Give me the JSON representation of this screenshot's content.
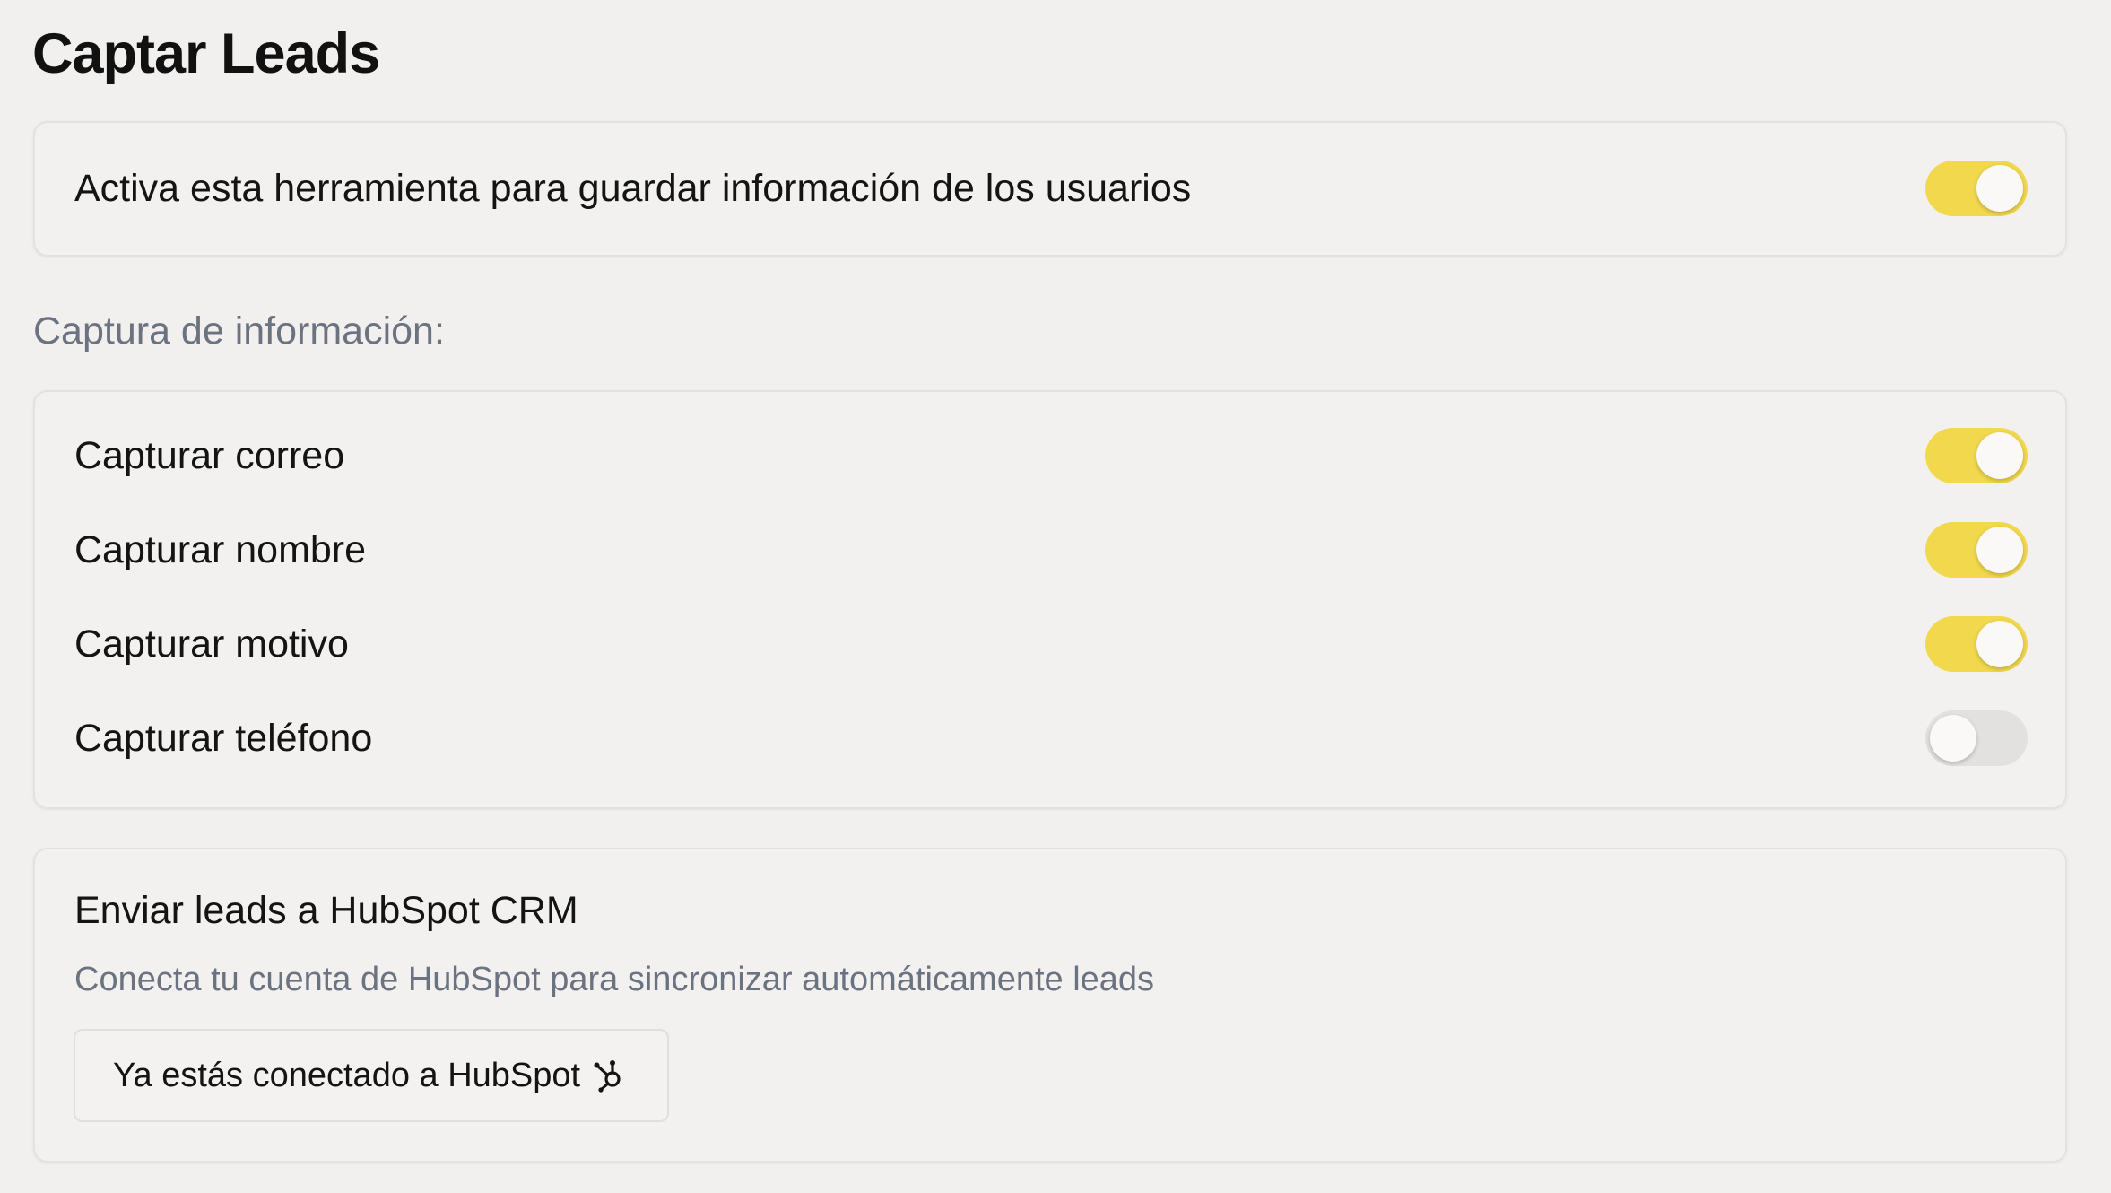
{
  "page": {
    "title": "Captar Leads"
  },
  "main_toggle": {
    "label": "Activa esta herramienta para guardar información de los usuarios",
    "enabled": true
  },
  "capture": {
    "section_label": "Captura de información:",
    "items": [
      {
        "label": "Capturar correo",
        "enabled": true
      },
      {
        "label": "Capturar nombre",
        "enabled": true
      },
      {
        "label": "Capturar motivo",
        "enabled": true
      },
      {
        "label": "Capturar teléfono",
        "enabled": false
      }
    ]
  },
  "hubspot": {
    "title": "Enviar leads a HubSpot CRM",
    "description": "Conecta tu cuenta de HubSpot para sincronizar automáticamente leads",
    "button_label": "Ya estás conectado a HubSpot",
    "button_icon": "hubspot-icon"
  },
  "colors": {
    "toggle_on": "#f1d84d",
    "toggle_off": "#e2e1df",
    "background": "#f1f0ee",
    "muted_text": "#6b7280"
  }
}
